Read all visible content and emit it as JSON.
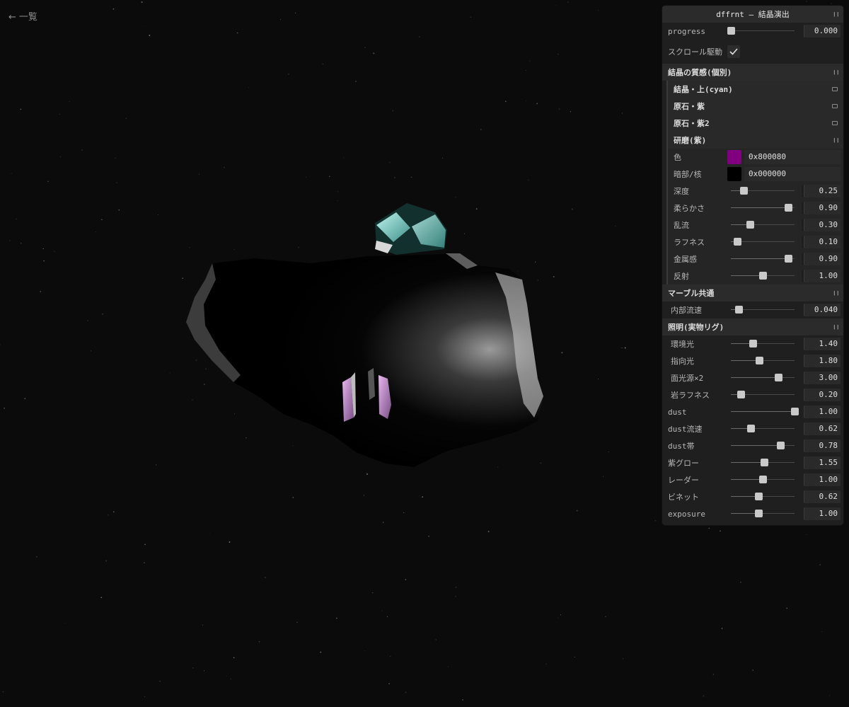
{
  "nav": {
    "back_arrow": "←",
    "back_label": "一覧"
  },
  "colors": {
    "background": "#0b0b0b",
    "panel": "#1f1f1f",
    "cyan_crystal": "#7fe6dc",
    "purple_crystal": "#c58ad8"
  },
  "gui": {
    "title": "dffrnt — 結晶演出",
    "top_rows": [
      {
        "label": "progress",
        "value": "0.000",
        "fraction": 0.0
      }
    ],
    "scroll_toggle": {
      "label": "スクロール駆動",
      "checked": true
    },
    "folder_crystal": {
      "title": "結晶の質感(個別)",
      "subfolders_closed": [
        "結晶・上(cyan)",
        "原石・紫",
        "原石・紫2"
      ],
      "open_sub": {
        "title": "研磨(紫)",
        "color": {
          "label": "色",
          "hex": "0x800080",
          "swatch": "#800080"
        },
        "dark": {
          "label": "暗部/核",
          "hex": "0x000000",
          "swatch": "#000000"
        },
        "sliders": [
          {
            "label": "深度",
            "value": "0.25",
            "fraction": 0.2
          },
          {
            "label": "柔らかさ",
            "value": "0.90",
            "fraction": 0.9
          },
          {
            "label": "乱流",
            "value": "0.30",
            "fraction": 0.3
          },
          {
            "label": "ラフネス",
            "value": "0.10",
            "fraction": 0.1
          },
          {
            "label": "金属感",
            "value": "0.90",
            "fraction": 0.9
          },
          {
            "label": "反射",
            "value": "1.00",
            "fraction": 0.5
          }
        ]
      }
    },
    "folder_marble": {
      "title": "マーブル共通",
      "sliders": [
        {
          "label": "内部流速",
          "value": "0.040",
          "fraction": 0.13
        }
      ]
    },
    "folder_light": {
      "title": "照明(実物リグ)",
      "sliders": [
        {
          "label": "環境光",
          "value": "1.40",
          "fraction": 0.35
        },
        {
          "label": "指向光",
          "value": "1.80",
          "fraction": 0.45
        },
        {
          "label": "面光源×2",
          "value": "3.00",
          "fraction": 0.75
        },
        {
          "label": "岩ラフネス",
          "value": "0.20",
          "fraction": 0.16
        }
      ]
    },
    "bottom_sliders": [
      {
        "label": "dust",
        "value": "1.00",
        "fraction": 1.0
      },
      {
        "label": "dust流速",
        "value": "0.62",
        "fraction": 0.31
      },
      {
        "label": "dust帯",
        "value": "0.78",
        "fraction": 0.78
      },
      {
        "label": "紫グロー",
        "value": "1.55",
        "fraction": 0.52
      },
      {
        "label": "レーダー",
        "value": "1.00",
        "fraction": 0.5
      },
      {
        "label": "ビネット",
        "value": "0.62",
        "fraction": 0.44
      },
      {
        "label": "exposure",
        "value": "1.00",
        "fraction": 0.44
      }
    ]
  }
}
